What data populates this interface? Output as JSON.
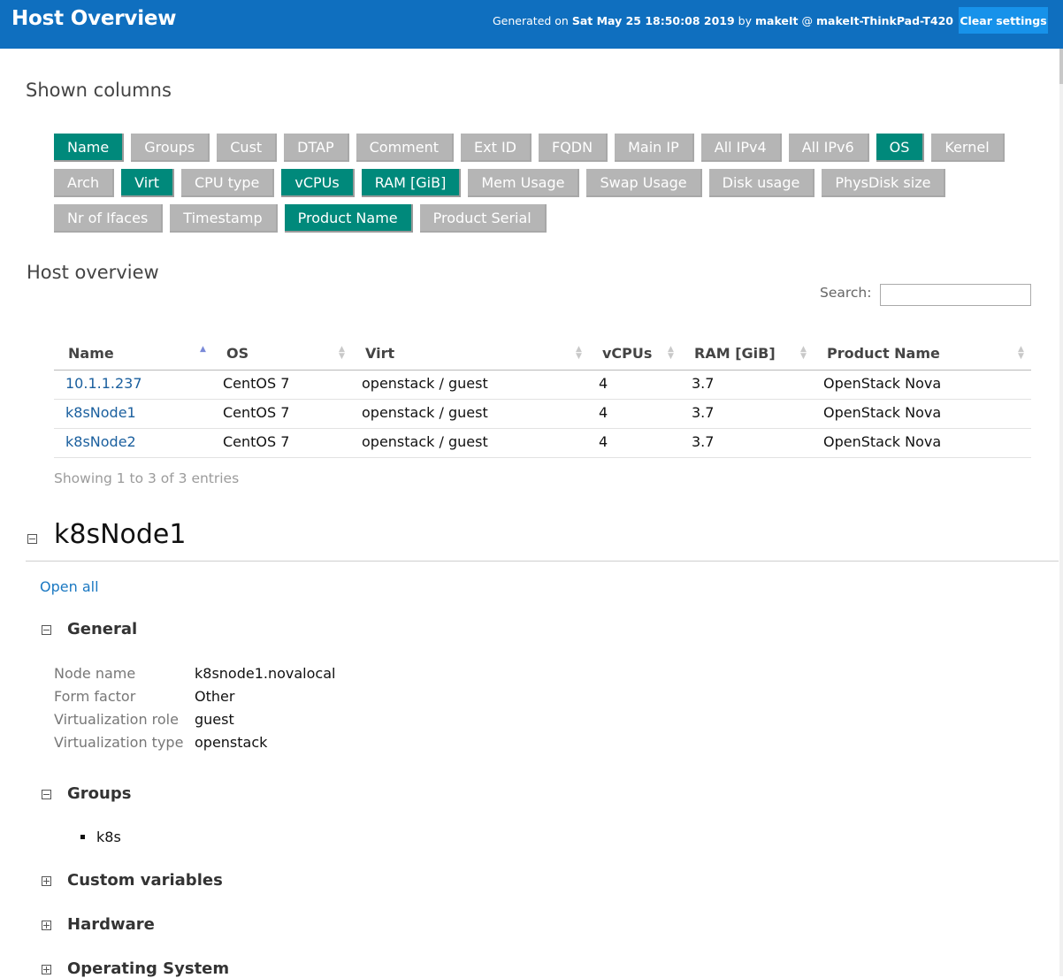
{
  "header": {
    "title": "Host Overview",
    "generated_prefix": "Generated on",
    "generated_date": "Sat May 25 18:50:08 2019",
    "by": "by",
    "user": "makeIt",
    "at": "@",
    "host": "makeIt-ThinkPad-T420",
    "clear_settings": "Clear settings"
  },
  "shown_columns": {
    "heading": "Shown columns",
    "rows": [
      [
        {
          "label": "Name",
          "active": true
        },
        {
          "label": "Groups",
          "active": false
        },
        {
          "label": "Cust",
          "active": false
        },
        {
          "label": "DTAP",
          "active": false
        },
        {
          "label": "Comment",
          "active": false
        },
        {
          "label": "Ext ID",
          "active": false
        },
        {
          "label": "FQDN",
          "active": false
        },
        {
          "label": "Main IP",
          "active": false
        },
        {
          "label": "All IPv4",
          "active": false
        },
        {
          "label": "All IPv6",
          "active": false
        },
        {
          "label": "OS",
          "active": true
        },
        {
          "label": "Kernel",
          "active": false
        }
      ],
      [
        {
          "label": "Arch",
          "active": false
        },
        {
          "label": "Virt",
          "active": true
        },
        {
          "label": "CPU type",
          "active": false
        },
        {
          "label": "vCPUs",
          "active": true
        },
        {
          "label": "RAM [GiB]",
          "active": true
        },
        {
          "label": "Mem Usage",
          "active": false
        },
        {
          "label": "Swap Usage",
          "active": false
        },
        {
          "label": "Disk usage",
          "active": false
        },
        {
          "label": "PhysDisk size",
          "active": false
        }
      ],
      [
        {
          "label": "Nr of Ifaces",
          "active": false
        },
        {
          "label": "Timestamp",
          "active": false
        },
        {
          "label": "Product Name",
          "active": true
        },
        {
          "label": "Product Serial",
          "active": false
        }
      ]
    ]
  },
  "host_overview": {
    "heading": "Host overview",
    "search_label": "Search:",
    "search_value": "",
    "columns": [
      "Name",
      "OS",
      "Virt",
      "vCPUs",
      "RAM [GiB]",
      "Product Name"
    ],
    "rows": [
      [
        "10.1.1.237",
        "CentOS 7",
        "openstack / guest",
        "4",
        "3.7",
        "OpenStack Nova"
      ],
      [
        "k8sNode1",
        "CentOS 7",
        "openstack / guest",
        "4",
        "3.7",
        "OpenStack Nova"
      ],
      [
        "k8sNode2",
        "CentOS 7",
        "openstack / guest",
        "4",
        "3.7",
        "OpenStack Nova"
      ]
    ],
    "showing": "Showing 1 to 3 of 3 entries"
  },
  "host_detail": {
    "title": "k8sNode1",
    "open_all": "Open all",
    "general": {
      "title": "General",
      "items": [
        {
          "key": "Node name",
          "value": "k8snode1.novalocal"
        },
        {
          "key": "Form factor",
          "value": "Other"
        },
        {
          "key": "Virtualization role",
          "value": "guest"
        },
        {
          "key": "Virtualization type",
          "value": "openstack"
        }
      ]
    },
    "groups": {
      "title": "Groups",
      "items": [
        "k8s"
      ]
    },
    "custom_variables": {
      "title": "Custom variables"
    },
    "hardware": {
      "title": "Hardware"
    },
    "operating_system": {
      "title": "Operating System"
    }
  }
}
